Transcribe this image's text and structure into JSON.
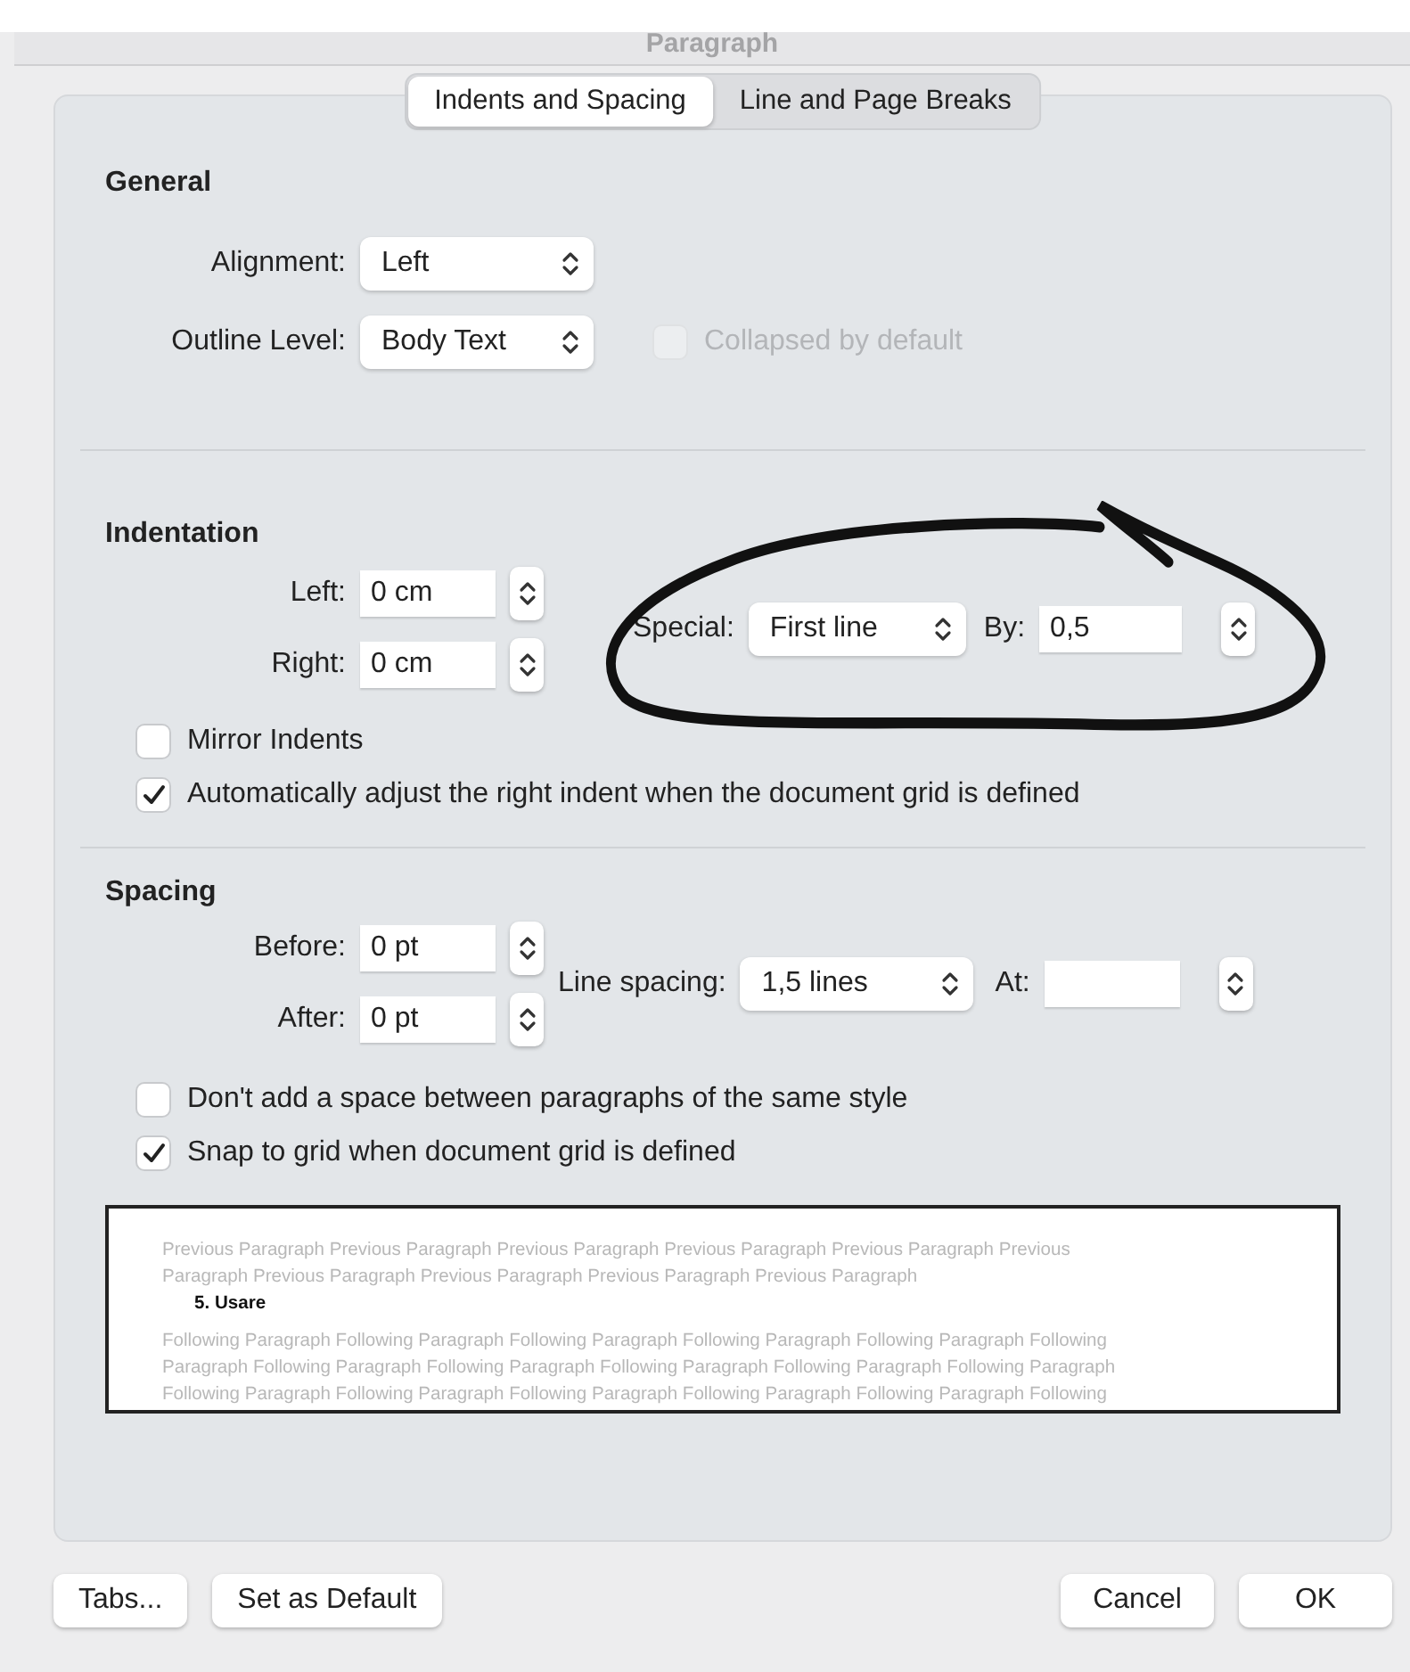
{
  "window": {
    "title": "Paragraph"
  },
  "tabs": [
    {
      "label": "Indents and Spacing",
      "selected": true
    },
    {
      "label": "Line and Page Breaks",
      "selected": false
    }
  ],
  "general": {
    "heading": "General",
    "alignment": {
      "label": "Alignment:",
      "value": "Left"
    },
    "outline_level": {
      "label": "Outline Level:",
      "value": "Body Text"
    },
    "collapsed": {
      "label": "Collapsed by default",
      "checked": false,
      "disabled": true
    }
  },
  "indentation": {
    "heading": "Indentation",
    "left": {
      "label": "Left:",
      "value": "0 cm"
    },
    "right": {
      "label": "Right:",
      "value": "0 cm"
    },
    "special": {
      "label": "Special:",
      "value": "First line"
    },
    "by": {
      "label": "By:",
      "value": "0,5"
    },
    "checkboxes": [
      {
        "label": "Mirror Indents",
        "checked": false
      },
      {
        "label": "Automatically adjust the right indent when the document grid is defined",
        "checked": true
      }
    ]
  },
  "spacing": {
    "heading": "Spacing",
    "before": {
      "label": "Before:",
      "value": "0 pt"
    },
    "after": {
      "label": "After:",
      "value": "0 pt"
    },
    "line_spacing": {
      "label": "Line spacing:",
      "value": "1,5 lines"
    },
    "at": {
      "label": "At:"
    },
    "checkboxes": [
      {
        "label": "Don't add a space between paragraphs of the same style",
        "checked": false
      },
      {
        "label": "Snap to grid when document grid is defined",
        "checked": true
      }
    ]
  },
  "preview": {
    "previous": [
      "Previous Paragraph Previous Paragraph Previous Paragraph Previous Paragraph Previous Paragraph Previous",
      "Paragraph Previous Paragraph Previous Paragraph Previous Paragraph Previous Paragraph"
    ],
    "current": "5. Usare",
    "following": [
      "Following Paragraph Following Paragraph Following Paragraph Following Paragraph Following Paragraph Following",
      "Paragraph Following Paragraph Following Paragraph Following Paragraph Following Paragraph Following Paragraph",
      "Following Paragraph Following Paragraph Following Paragraph Following Paragraph Following Paragraph Following"
    ]
  },
  "buttons_left": [
    "Tabs...",
    "Set as Default"
  ],
  "buttons_right": [
    "Cancel",
    "OK"
  ]
}
